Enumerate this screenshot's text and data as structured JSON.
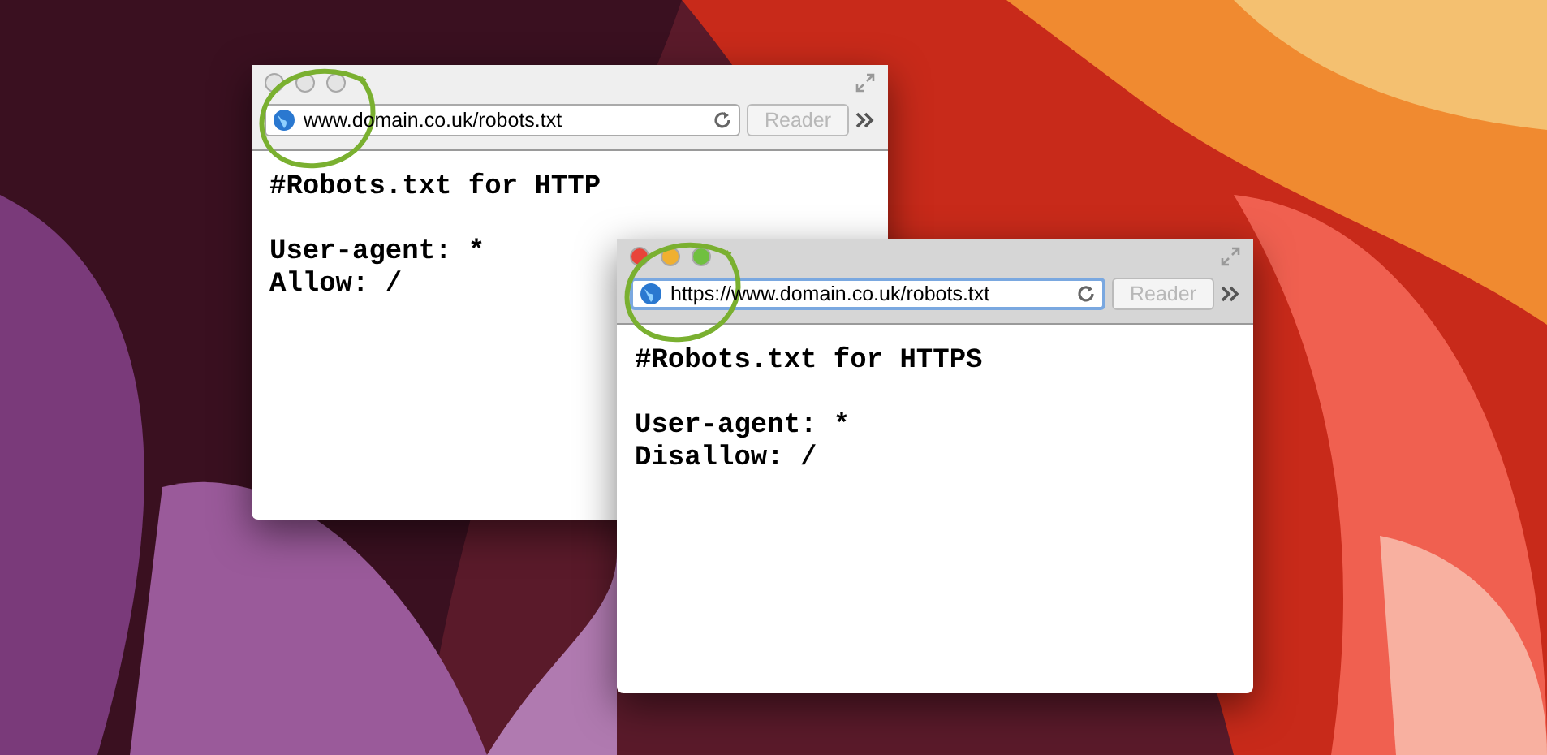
{
  "windows": [
    {
      "active": false,
      "url": "www.domain.co.uk/robots.txt",
      "reader": "Reader",
      "blocks": [
        [
          "#Robots.txt for HTTP"
        ],
        [
          "User-agent: *",
          "Allow: /"
        ]
      ]
    },
    {
      "active": true,
      "url": "https://www.domain.co.uk/robots.txt",
      "reader": "Reader",
      "blocks": [
        [
          "#Robots.txt for HTTPS"
        ],
        [
          "User-agent: *",
          "Disallow: /"
        ]
      ]
    }
  ]
}
